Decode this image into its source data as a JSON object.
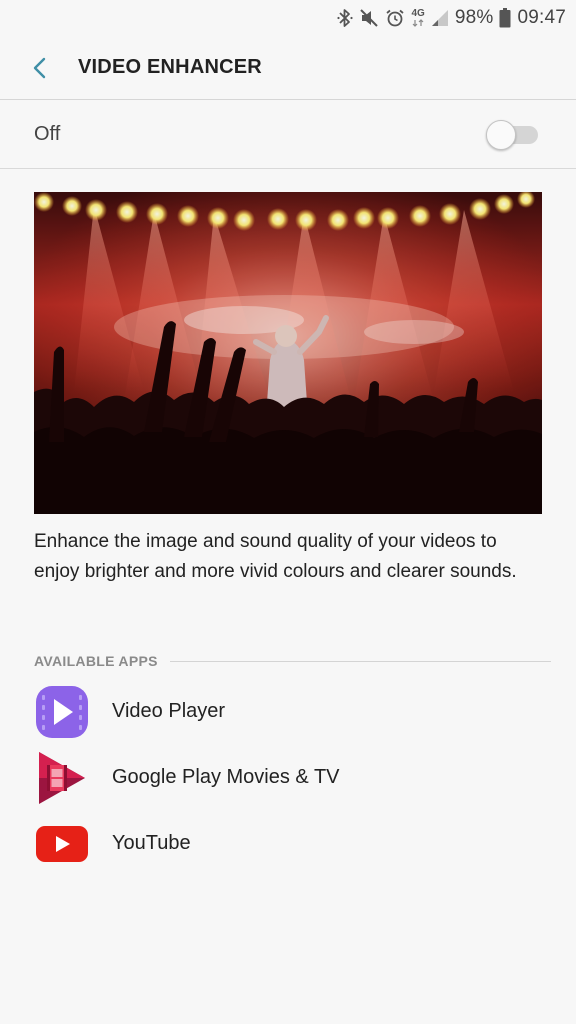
{
  "status_bar": {
    "battery": "98%",
    "time": "09:47",
    "network_type": "4G",
    "icons": [
      "bluetooth-icon",
      "mute-icon",
      "alarm-icon",
      "network-4g-icon",
      "signal-icon",
      "battery-icon"
    ]
  },
  "header": {
    "title": "VIDEO ENHANCER",
    "back_icon": "chevron-left-icon"
  },
  "master_switch": {
    "label": "Off",
    "enabled": false
  },
  "hero_image": {
    "subject": "concert crowd under stage lights"
  },
  "description": "Enhance the image and sound quality of your videos to enjoy brighter and more vivid colours and clearer sounds.",
  "available_apps": {
    "title": "AVAILABLE APPS",
    "items": [
      {
        "label": "Video Player",
        "icon": "video-player-icon"
      },
      {
        "label": "Google Play Movies & TV",
        "icon": "play-movies-icon"
      },
      {
        "label": "YouTube",
        "icon": "youtube-icon"
      }
    ]
  },
  "colors": {
    "accent": "#3f8fa6",
    "background": "#f7f7f7",
    "video_player": "#8c63e8",
    "play_movies": "#d4204f",
    "youtube": "#e62117"
  }
}
